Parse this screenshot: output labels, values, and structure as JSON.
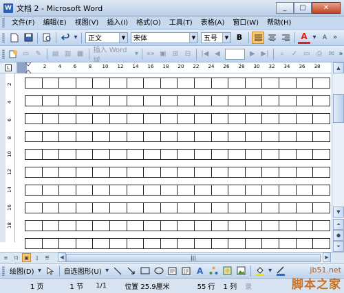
{
  "window": {
    "title": "文档 2 - Microsoft Word",
    "icon_glyph": "W",
    "minimize": "_",
    "maximize": "□",
    "close": "✕"
  },
  "menu": {
    "items": [
      "文件(F)",
      "编辑(E)",
      "视图(V)",
      "插入(I)",
      "格式(O)",
      "工具(T)",
      "表格(A)",
      "窗口(W)",
      "帮助(H)"
    ]
  },
  "toolbar_format": {
    "style_value": "正文",
    "font_value": "宋体",
    "size_value": "五号",
    "bold": "B",
    "font_color": "A",
    "grow": "A"
  },
  "toolbar_mail": {
    "insert_word_field": "插入 Word 域"
  },
  "ruler": {
    "ticks": [
      "2",
      "4",
      "6",
      "8",
      "10",
      "12",
      "14",
      "16",
      "18",
      "20",
      "22",
      "24",
      "26",
      "28",
      "30",
      "32",
      "34",
      "36",
      "38"
    ],
    "vticks": [
      "2",
      "4",
      "6",
      "8",
      "10",
      "12",
      "14",
      "16",
      "18"
    ],
    "tab_glyph": "L"
  },
  "drawing": {
    "draw_label": "绘图(D)",
    "autoshapes_label": "自选图形(U)"
  },
  "status": {
    "page": "1 页",
    "section": "1 节",
    "page_of": "1/1",
    "position": "位置 25.9厘米",
    "line": "55 行",
    "column": "1 列",
    "rec": "录"
  },
  "watermark": {
    "site": "jb51.net",
    "brand": "脚本之家"
  },
  "colors": {
    "accent_active": "#ffc76b",
    "font_color_red": "#e02020",
    "title_gradient_top": "#dfe9f5"
  }
}
